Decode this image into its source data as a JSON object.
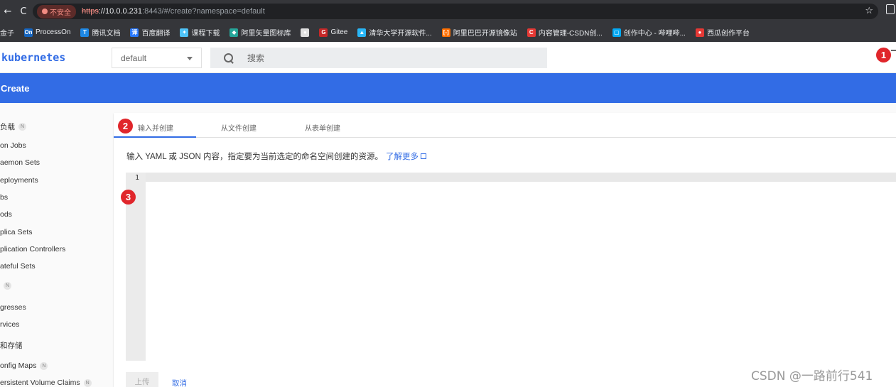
{
  "browser": {
    "security_label": "不安全",
    "url_protocol": "https",
    "url_host": "://10.0.0.231",
    "url_rest": ":8443/#/create?namespace=default",
    "back_glyph": "←",
    "reload_glyph": "C",
    "star_glyph": "☆",
    "bookmarks": [
      {
        "label": "金子",
        "color": "#35363a",
        "glyph": ""
      },
      {
        "label": "ProcessOn",
        "color": "#1565c0",
        "glyph": "On"
      },
      {
        "label": "腾讯文档",
        "color": "#1e88e5",
        "glyph": "T"
      },
      {
        "label": "百度翻译",
        "color": "#2979ff",
        "glyph": "译"
      },
      {
        "label": "课程下载",
        "color": "#4fc3f7",
        "glyph": "✦"
      },
      {
        "label": "阿里矢量图标库",
        "color": "#26a69a",
        "glyph": "◆"
      },
      {
        "label": "",
        "color": "#e0e0e0",
        "glyph": "●"
      },
      {
        "label": "Gitee",
        "color": "#c62828",
        "glyph": "G"
      },
      {
        "label": "清华大学开源软件...",
        "color": "#29b6f6",
        "glyph": "▲"
      },
      {
        "label": "阿里巴巴开源镜像站",
        "color": "#ff6f00",
        "glyph": "[-]"
      },
      {
        "label": "内容管理-CSDN创...",
        "color": "#e53935",
        "glyph": "C"
      },
      {
        "label": "创作中心 - 哔哩哔...",
        "color": "#03a9f4",
        "glyph": "▢"
      },
      {
        "label": "西瓜创作平台",
        "color": "#e53935",
        "glyph": "●"
      }
    ]
  },
  "toolbar": {
    "brand": "kubernetes",
    "namespace_value": "default",
    "search_placeholder": "搜索"
  },
  "header": {
    "title": "Create"
  },
  "sidebar": {
    "items": [
      {
        "label": "负载",
        "badge": "N"
      },
      {
        "label": "on Jobs",
        "badge": ""
      },
      {
        "label": "aemon Sets",
        "badge": ""
      },
      {
        "label": "eployments",
        "badge": ""
      },
      {
        "label": "bs",
        "badge": ""
      },
      {
        "label": "ods",
        "badge": ""
      },
      {
        "label": "plica Sets",
        "badge": ""
      },
      {
        "label": "plication Controllers",
        "badge": ""
      },
      {
        "label": "ateful Sets",
        "badge": ""
      },
      {
        "label": "",
        "badge": "N"
      },
      {
        "label": "gresses",
        "badge": ""
      },
      {
        "label": "rvices",
        "badge": ""
      },
      {
        "label": "和存储",
        "badge": ""
      },
      {
        "label": "onfig Maps",
        "badge": "N"
      },
      {
        "label": "ersistent Volume Claims",
        "badge": "N"
      }
    ]
  },
  "main": {
    "tabs": [
      {
        "label": "输入并创建"
      },
      {
        "label": "从文件创建"
      },
      {
        "label": "从表单创建"
      }
    ],
    "description": "输入 YAML 或 JSON 内容，指定要为当前选定的命名空间创建的资源。",
    "learn_more": "了解更多",
    "line_number": "1",
    "upload_label": "上传",
    "cancel_label": "取消"
  },
  "annotations": {
    "one": "1",
    "two": "2",
    "three": "3"
  },
  "watermark": "CSDN @一路前行541",
  "colors": {
    "accent": "#326ce5",
    "annotation_red": "#e0262b",
    "chrome": "#35363a"
  }
}
